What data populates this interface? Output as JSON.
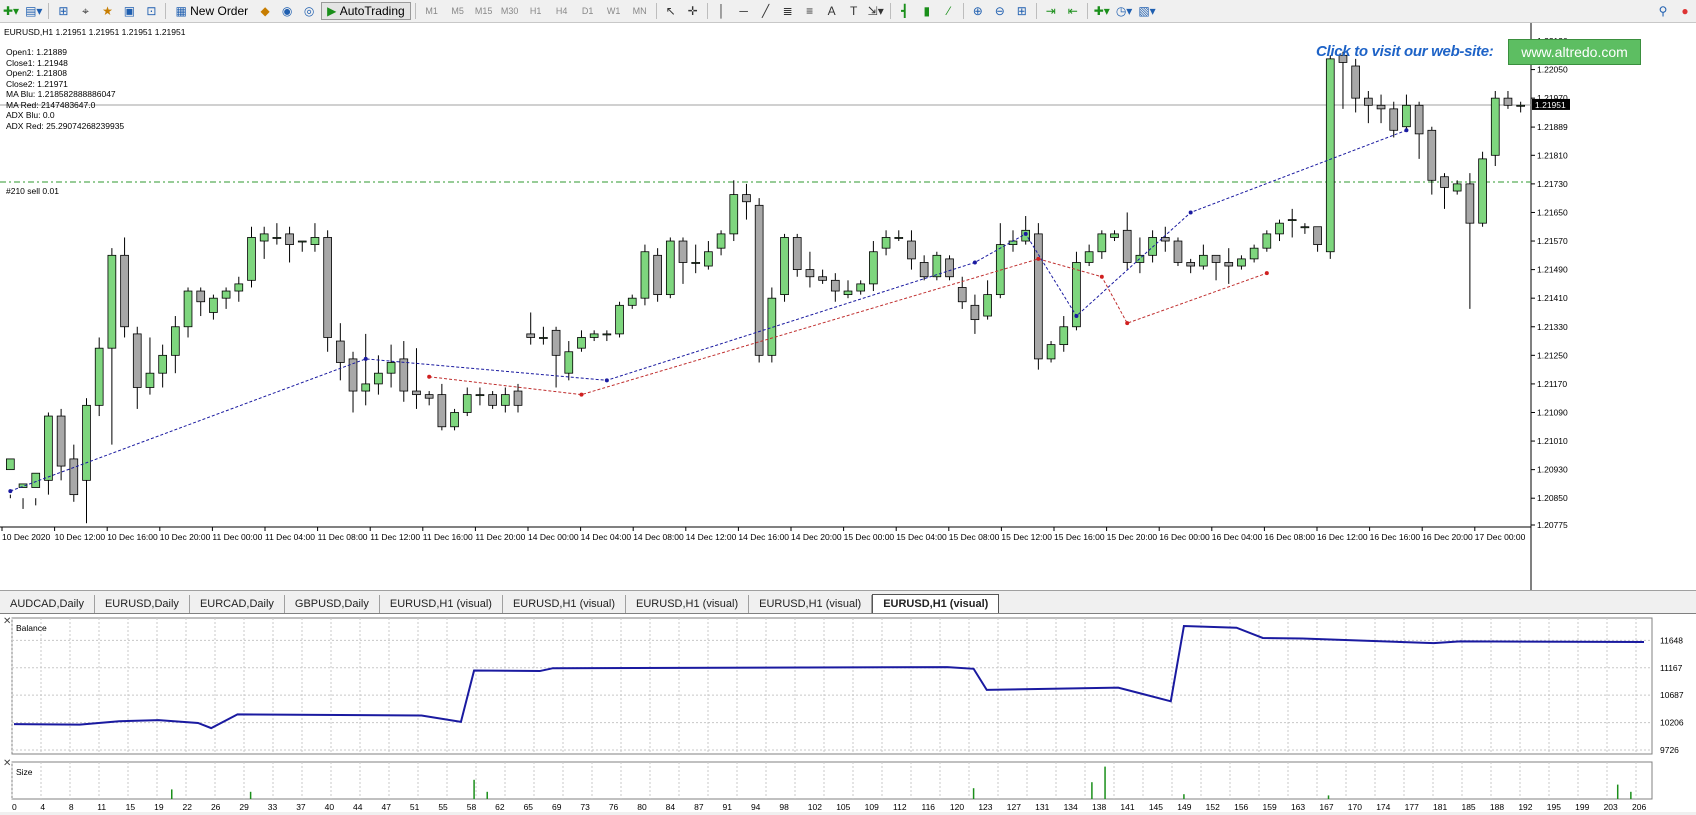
{
  "toolbar": {
    "new_order": "New Order",
    "auto_trading": "AutoTrading",
    "timeframes": [
      "M1",
      "M5",
      "M15",
      "M30",
      "H1",
      "H4",
      "D1",
      "W1",
      "MN"
    ]
  },
  "chart": {
    "symbol_line": "EURUSD,H1  1.21951 1.21951 1.21951 1.21951",
    "indicators": [
      "Open1: 1.21889",
      "Close1: 1.21948",
      "Open2: 1.21808",
      "Close2: 1.21971",
      "MA Blu: 1.218582888886047",
      "MA Red: 2147483647.0",
      "ADX Blu: 0.0",
      "ADX Red: 25.29074268239935"
    ],
    "order_label": "#210 sell 0.01",
    "visit_text": "Click to visit our web-site:",
    "site_button": "www.altredo.com",
    "current_price": "1.21951",
    "price_axis": [
      "1.22130",
      "1.22050",
      "1.21970",
      "1.21889",
      "1.21810",
      "1.21730",
      "1.21650",
      "1.21570",
      "1.21490",
      "1.21410",
      "1.21330",
      "1.21250",
      "1.21170",
      "1.21090",
      "1.21010",
      "1.20930",
      "1.20850",
      "1.20775"
    ],
    "time_axis": [
      "10 Dec 2020",
      "10 Dec 12:00",
      "10 Dec 16:00",
      "10 Dec 20:00",
      "11 Dec 00:00",
      "11 Dec 04:00",
      "11 Dec 08:00",
      "11 Dec 12:00",
      "11 Dec 16:00",
      "11 Dec 20:00",
      "14 Dec 00:00",
      "14 Dec 04:00",
      "14 Dec 08:00",
      "14 Dec 12:00",
      "14 Dec 16:00",
      "14 Dec 20:00",
      "15 Dec 00:00",
      "15 Dec 04:00",
      "15 Dec 08:00",
      "15 Dec 12:00",
      "15 Dec 16:00",
      "15 Dec 20:00",
      "16 Dec 00:00",
      "16 Dec 04:00",
      "16 Dec 08:00",
      "16 Dec 12:00",
      "16 Dec 16:00",
      "16 Dec 20:00",
      "17 Dec 00:00"
    ],
    "colors": {
      "bull": "#7ed67e",
      "bear": "#a8a8a8",
      "ma_blue": "#1a1aa0",
      "ma_red": "#c03030",
      "order_line": "#2f9a2f"
    },
    "candles": [
      [
        1.2093,
        1.2096,
        1.2086,
        1.2085
      ],
      [
        1.2088,
        1.2089,
        1.2085,
        1.2082
      ],
      [
        1.2088,
        1.2092,
        1.2085,
        1.2083
      ],
      [
        1.209,
        1.2108,
        1.2109,
        1.2086
      ],
      [
        1.2108,
        1.2094,
        1.211,
        1.209
      ],
      [
        1.2096,
        1.2086,
        1.21,
        1.2084
      ],
      [
        1.209,
        1.2111,
        1.2113,
        1.2078
      ],
      [
        1.2111,
        1.2127,
        1.213,
        1.2108
      ],
      [
        1.2127,
        1.2153,
        1.2155,
        1.21
      ],
      [
        1.2153,
        1.2133,
        1.2158,
        1.213
      ],
      [
        1.2131,
        1.2116,
        1.2133,
        1.211
      ],
      [
        1.2116,
        1.212,
        1.213,
        1.2114
      ],
      [
        1.212,
        1.2125,
        1.2128,
        1.2116
      ],
      [
        1.2125,
        1.2133,
        1.2136,
        1.212
      ],
      [
        1.2133,
        1.2143,
        1.2144,
        1.213
      ],
      [
        1.2143,
        1.214,
        1.2144,
        1.2136
      ],
      [
        1.2137,
        1.2141,
        1.2142,
        1.2135
      ],
      [
        1.2141,
        1.2143,
        1.2144,
        1.2138
      ],
      [
        1.2143,
        1.2145,
        1.2147,
        1.214
      ],
      [
        1.2146,
        1.2158,
        1.2161,
        1.2144
      ],
      [
        1.2157,
        1.2159,
        1.2161,
        1.2152
      ],
      [
        1.2158,
        1.2158,
        1.2162,
        1.2156
      ],
      [
        1.2159,
        1.2156,
        1.2161,
        1.2151
      ],
      [
        1.2157,
        1.2157,
        1.2157,
        1.2154
      ],
      [
        1.2156,
        1.2158,
        1.2162,
        1.2154
      ],
      [
        1.2158,
        1.213,
        1.216,
        1.2126
      ],
      [
        1.2129,
        1.2123,
        1.2134,
        1.2118
      ],
      [
        1.2124,
        1.2115,
        1.2126,
        1.2109
      ],
      [
        1.2115,
        1.2117,
        1.2131,
        1.2111
      ],
      [
        1.2117,
        1.212,
        1.2125,
        1.2114
      ],
      [
        1.212,
        1.2123,
        1.2128,
        1.2116
      ],
      [
        1.2124,
        1.2115,
        1.2129,
        1.2112
      ],
      [
        1.2115,
        1.2114,
        1.2127,
        1.211
      ],
      [
        1.2114,
        1.2113,
        1.2115,
        1.2111
      ],
      [
        1.2114,
        1.2105,
        1.2117,
        1.2104
      ],
      [
        1.2105,
        1.2109,
        1.211,
        1.2104
      ],
      [
        1.2109,
        1.2114,
        1.2116,
        1.2108
      ],
      [
        1.2114,
        1.2114,
        1.2116,
        1.2111
      ],
      [
        1.2114,
        1.2111,
        1.2115,
        1.211
      ],
      [
        1.2111,
        1.2114,
        1.2116,
        1.2109
      ],
      [
        1.2115,
        1.2111,
        1.2117,
        1.2109
      ],
      [
        1.2131,
        1.213,
        1.2137,
        1.2128
      ],
      [
        1.213,
        1.213,
        1.2133,
        1.2128
      ],
      [
        1.2132,
        1.2125,
        1.2133,
        1.2116
      ],
      [
        1.212,
        1.2126,
        1.2129,
        1.2118
      ],
      [
        1.2127,
        1.213,
        1.2132,
        1.2126
      ],
      [
        1.213,
        1.2131,
        1.2132,
        1.2129
      ],
      [
        1.2131,
        1.2131,
        1.2132,
        1.2129
      ],
      [
        1.2131,
        1.2139,
        1.214,
        1.213
      ],
      [
        1.2139,
        1.2141,
        1.2142,
        1.2138
      ],
      [
        1.2141,
        1.2154,
        1.2156,
        1.2139
      ],
      [
        1.2153,
        1.2142,
        1.2155,
        1.214
      ],
      [
        1.2142,
        1.2157,
        1.2158,
        1.2141
      ],
      [
        1.2157,
        1.2151,
        1.2158,
        1.2145
      ],
      [
        1.2151,
        1.2151,
        1.2156,
        1.2148
      ],
      [
        1.215,
        1.2154,
        1.2157,
        1.2149
      ],
      [
        1.2155,
        1.2159,
        1.216,
        1.2153
      ],
      [
        1.2159,
        1.217,
        1.2174,
        1.2157
      ],
      [
        1.217,
        1.2168,
        1.2173,
        1.2163
      ],
      [
        1.2167,
        1.2125,
        1.2169,
        1.2123
      ],
      [
        1.2125,
        1.2141,
        1.2144,
        1.2123
      ],
      [
        1.2142,
        1.2158,
        1.2159,
        1.214
      ],
      [
        1.2158,
        1.2149,
        1.2159,
        1.2147
      ],
      [
        1.2149,
        1.2147,
        1.2154,
        1.2144
      ],
      [
        1.2147,
        1.2146,
        1.2149,
        1.2145
      ],
      [
        1.2146,
        1.2143,
        1.2148,
        1.214
      ],
      [
        1.2142,
        1.2143,
        1.2146,
        1.2141
      ],
      [
        1.2143,
        1.2145,
        1.2146,
        1.2142
      ],
      [
        1.2145,
        1.2154,
        1.2157,
        1.2143
      ],
      [
        1.2155,
        1.2158,
        1.216,
        1.2153
      ],
      [
        1.2158,
        1.2158,
        1.216,
        1.2157
      ],
      [
        1.2157,
        1.2152,
        1.216,
        1.2149
      ],
      [
        1.2151,
        1.2147,
        1.2153,
        1.2146
      ],
      [
        1.2147,
        1.2153,
        1.2154,
        1.2146
      ],
      [
        1.2152,
        1.2147,
        1.2153,
        1.2146
      ],
      [
        1.2144,
        1.214,
        1.2147,
        1.2138
      ],
      [
        1.2139,
        1.2135,
        1.2142,
        1.2131
      ],
      [
        1.2136,
        1.2142,
        1.2146,
        1.2135
      ],
      [
        1.2142,
        1.2156,
        1.2162,
        1.2141
      ],
      [
        1.2156,
        1.2157,
        1.216,
        1.2154
      ],
      [
        1.2157,
        1.216,
        1.2164,
        1.2156
      ],
      [
        1.2159,
        1.2124,
        1.2162,
        1.2121
      ],
      [
        1.2124,
        1.2128,
        1.2129,
        1.2123
      ],
      [
        1.2128,
        1.2133,
        1.2136,
        1.2126
      ],
      [
        1.2133,
        1.2151,
        1.2154,
        1.2132
      ],
      [
        1.2151,
        1.2154,
        1.2156,
        1.215
      ],
      [
        1.2154,
        1.2159,
        1.216,
        1.2152
      ],
      [
        1.2158,
        1.2159,
        1.216,
        1.2157
      ],
      [
        1.216,
        1.2151,
        1.2165,
        1.2149
      ],
      [
        1.2151,
        1.2153,
        1.2158,
        1.2148
      ],
      [
        1.2153,
        1.2158,
        1.216,
        1.2151
      ],
      [
        1.2158,
        1.2157,
        1.2161,
        1.2154
      ],
      [
        1.2157,
        1.2151,
        1.2158,
        1.215
      ],
      [
        1.2151,
        1.215,
        1.2152,
        1.2148
      ],
      [
        1.215,
        1.2153,
        1.2156,
        1.2149
      ],
      [
        1.2153,
        1.2151,
        1.2153,
        1.2146
      ],
      [
        1.2151,
        1.215,
        1.2155,
        1.2145
      ],
      [
        1.215,
        1.2152,
        1.2153,
        1.2149
      ],
      [
        1.2152,
        1.2155,
        1.2156,
        1.2151
      ],
      [
        1.2155,
        1.2159,
        1.216,
        1.2154
      ],
      [
        1.2159,
        1.2162,
        1.2163,
        1.2157
      ],
      [
        1.2163,
        1.2163,
        1.2166,
        1.2158
      ],
      [
        1.2161,
        1.2161,
        1.2162,
        1.2159
      ],
      [
        1.2161,
        1.2156,
        1.2161,
        1.2154
      ],
      [
        1.2154,
        1.2208,
        1.2209,
        1.2152
      ],
      [
        1.2209,
        1.2207,
        1.221,
        1.2194
      ],
      [
        1.2206,
        1.2197,
        1.2208,
        1.2193
      ],
      [
        1.2197,
        1.2195,
        1.2199,
        1.219
      ],
      [
        1.2195,
        1.2194,
        1.2198,
        1.219
      ],
      [
        1.2194,
        1.2188,
        1.2196,
        1.2186
      ],
      [
        1.2189,
        1.2195,
        1.2198,
        1.2188
      ],
      [
        1.2195,
        1.2187,
        1.2196,
        1.218
      ],
      [
        1.2188,
        1.2174,
        1.2189,
        1.217
      ],
      [
        1.2175,
        1.2172,
        1.2176,
        1.2166
      ],
      [
        1.2171,
        1.2173,
        1.2174,
        1.217
      ],
      [
        1.2173,
        1.2162,
        1.2176,
        1.2138
      ],
      [
        1.2162,
        1.218,
        1.2182,
        1.2161
      ],
      [
        1.2181,
        1.2197,
        1.2199,
        1.2178
      ],
      [
        1.2197,
        1.2195,
        1.2199,
        1.2194
      ],
      [
        1.2195,
        1.2195,
        1.2196,
        1.2193
      ]
    ],
    "ma_blue_points": [
      [
        0,
        1.2087
      ],
      [
        28,
        1.2124
      ],
      [
        47,
        1.2118
      ],
      [
        76,
        1.2151
      ],
      [
        80,
        1.2159
      ],
      [
        84,
        1.2136
      ],
      [
        93,
        1.2165
      ],
      [
        110,
        1.2188
      ]
    ],
    "ma_red_points": [
      [
        33,
        1.2119
      ],
      [
        45,
        1.2114
      ],
      [
        81,
        1.2152
      ],
      [
        86,
        1.2147
      ],
      [
        88,
        1.2134
      ],
      [
        99,
        1.2148
      ]
    ]
  },
  "tabs": [
    {
      "label": "AUDCAD,Daily"
    },
    {
      "label": "EURUSD,Daily"
    },
    {
      "label": "EURCAD,Daily"
    },
    {
      "label": "GBPUSD,Daily"
    },
    {
      "label": "EURUSD,H1 (visual)"
    },
    {
      "label": "EURUSD,H1 (visual)"
    },
    {
      "label": "EURUSD,H1 (visual)"
    },
    {
      "label": "EURUSD,H1 (visual)"
    },
    {
      "label": "EURUSD,H1 (visual)",
      "active": true
    }
  ],
  "balance": {
    "label": "Balance",
    "axis": [
      "11648",
      "11167",
      "10687",
      "10206",
      "9726"
    ],
    "points": [
      [
        0,
        10180
      ],
      [
        5,
        10170
      ],
      [
        8,
        10230
      ],
      [
        11,
        10250
      ],
      [
        14,
        10200
      ],
      [
        15,
        10110
      ],
      [
        17,
        10350
      ],
      [
        31,
        10330
      ],
      [
        34,
        10220
      ],
      [
        35,
        11120
      ],
      [
        40,
        11110
      ],
      [
        41,
        11160
      ],
      [
        71,
        11180
      ],
      [
        73,
        11150
      ],
      [
        74,
        10780
      ],
      [
        84,
        10820
      ],
      [
        88,
        10580
      ],
      [
        89,
        11900
      ],
      [
        93,
        11870
      ],
      [
        95,
        11690
      ],
      [
        98,
        11680
      ],
      [
        108,
        11600
      ],
      [
        110,
        11630
      ],
      [
        124,
        11620
      ]
    ]
  },
  "size": {
    "label": "Size",
    "axis": [
      "0",
      "4",
      "8",
      "11",
      "15",
      "19",
      "22",
      "26",
      "29",
      "33",
      "37",
      "40",
      "44",
      "47",
      "51",
      "55",
      "58",
      "62",
      "65",
      "69",
      "73",
      "76",
      "80",
      "84",
      "87",
      "91",
      "94",
      "98",
      "102",
      "105",
      "109",
      "112",
      "116",
      "120",
      "123",
      "127",
      "131",
      "134",
      "138",
      "141",
      "145",
      "149",
      "152",
      "156",
      "159",
      "163",
      "167",
      "170",
      "174",
      "177",
      "181",
      "185",
      "188",
      "192",
      "195",
      "199",
      "203",
      "206"
    ],
    "bars": [
      [
        12,
        8
      ],
      [
        18,
        6
      ],
      [
        35,
        16
      ],
      [
        36,
        6
      ],
      [
        73,
        9
      ],
      [
        82,
        14
      ],
      [
        83,
        27
      ],
      [
        89,
        4
      ],
      [
        100,
        3
      ],
      [
        122,
        12
      ],
      [
        123,
        6
      ]
    ]
  }
}
